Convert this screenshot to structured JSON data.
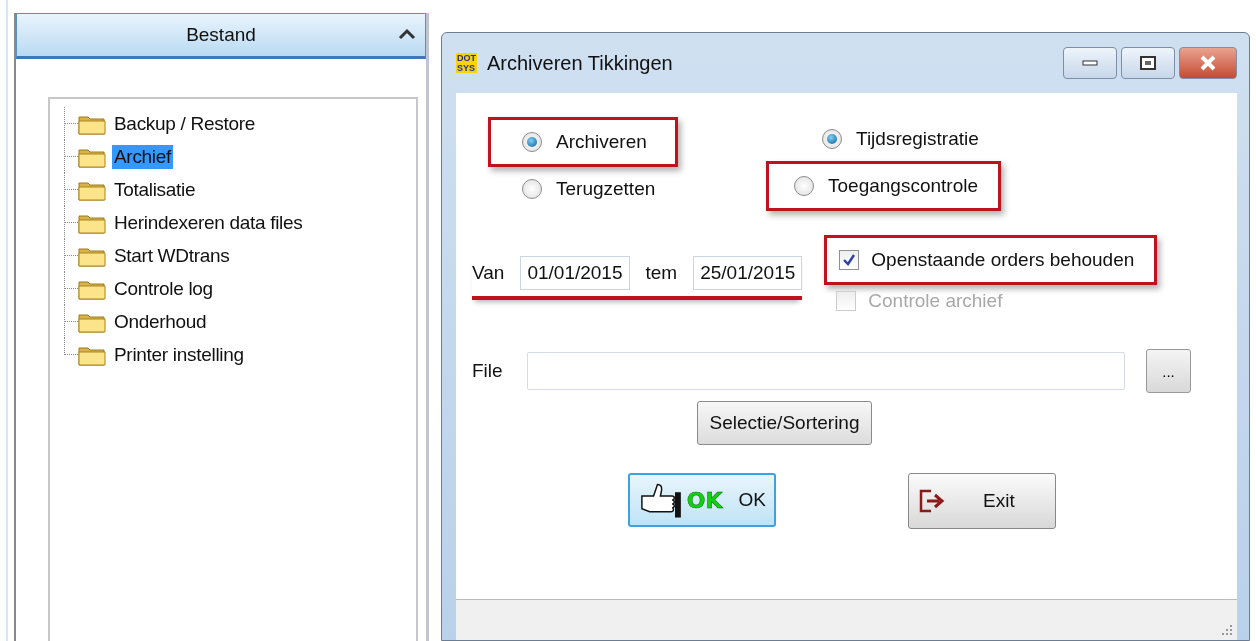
{
  "panel": {
    "title": "Bestand",
    "expanded": true,
    "items": [
      {
        "label": "Backup / Restore",
        "selected": false
      },
      {
        "label": "Archief",
        "selected": true
      },
      {
        "label": "Totalisatie",
        "selected": false
      },
      {
        "label": "Herindexeren data files",
        "selected": false
      },
      {
        "label": "Start WDtrans",
        "selected": false
      },
      {
        "label": "Controle log",
        "selected": false
      },
      {
        "label": "Onderhoud",
        "selected": false
      },
      {
        "label": "Printer instelling",
        "selected": false
      }
    ]
  },
  "dialog": {
    "title": "Archiveren Tikkingen",
    "logo": [
      "DOT",
      "SYS"
    ],
    "mode_options": [
      {
        "label": "Archiveren",
        "selected": true,
        "highlighted": true
      },
      {
        "label": "Terugzetten",
        "selected": false,
        "highlighted": false
      }
    ],
    "type_options": [
      {
        "label": "Tijdsregistratie",
        "selected": true,
        "highlighted": false
      },
      {
        "label": "Toegangscontrole",
        "selected": false,
        "highlighted": true
      }
    ],
    "from_label": "Van",
    "from_value": "01/01/2015",
    "to_label": "tem",
    "to_value": "25/01/2015",
    "dates_underlined": true,
    "checkboxes": [
      {
        "label": "Openstaande orders behouden",
        "checked": true,
        "disabled": false,
        "highlighted": true
      },
      {
        "label": "Controle archief",
        "checked": false,
        "disabled": true,
        "highlighted": false
      }
    ],
    "file_label": "File",
    "browse_button": "...",
    "selection_button": "Selectie/Sortering",
    "ok_button": {
      "badge": "OK",
      "label": "OK"
    },
    "exit_button": "Exit"
  }
}
